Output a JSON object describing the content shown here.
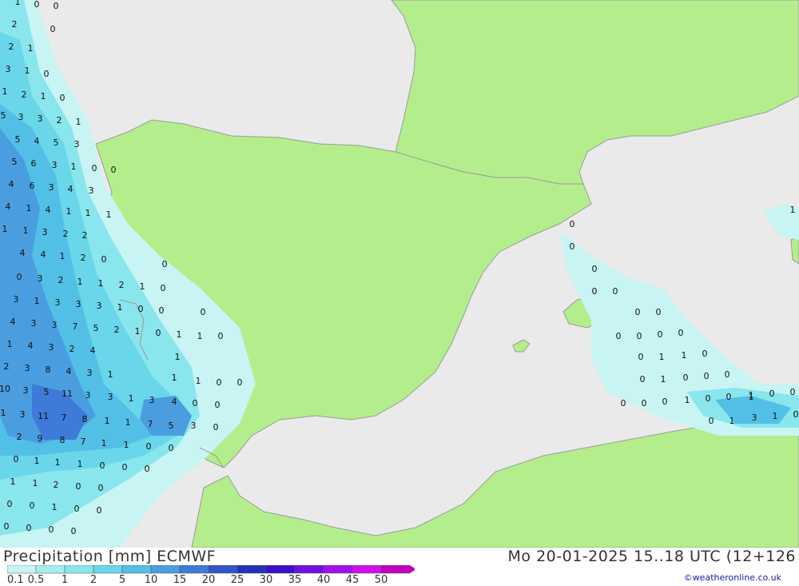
{
  "title_left": "Precipitation [mm] ECMWF",
  "title_right": "Mo 20-01-2025 15..18 UTC (12+126",
  "credit": "©weatheronline.co.uk",
  "legend": {
    "labels": [
      "0.1",
      "0.5",
      "1",
      "2",
      "5",
      "10",
      "15",
      "20",
      "25",
      "30",
      "35",
      "40",
      "45",
      "50"
    ],
    "colors": [
      "#c8f4f4",
      "#a6eef0",
      "#88e6ec",
      "#6ad6ea",
      "#52c0e6",
      "#4a9ee0",
      "#3e7ad8",
      "#3254cc",
      "#2232b8",
      "#3a10c8",
      "#7010e0",
      "#a010e8",
      "#d010e8",
      "#c000c0"
    ]
  },
  "map_colors": {
    "land": "#b4ee8c",
    "sea": "#eaeaea",
    "border": "#9a9a9a"
  },
  "values": [
    "1",
    "0",
    "0",
    "2",
    "0",
    "2",
    "1",
    "3",
    "1",
    "0",
    "1",
    "2",
    "1",
    "0",
    "5",
    "3",
    "3",
    "2",
    "1",
    "5",
    "4",
    "5",
    "3",
    "5",
    "6",
    "3",
    "1",
    "0",
    "0",
    "4",
    "6",
    "3",
    "4",
    "3",
    "4",
    "1",
    "4",
    "1",
    "1",
    "1",
    "1",
    "1",
    "3",
    "2",
    "2",
    "4",
    "4",
    "1",
    "2",
    "0",
    "0",
    "3",
    "2",
    "1",
    "1",
    "2",
    "1",
    "0",
    "0",
    "3",
    "1",
    "3",
    "3",
    "3",
    "1",
    "0",
    "0",
    "0",
    "4",
    "3",
    "3",
    "7",
    "5",
    "2",
    "1",
    "0",
    "1",
    "1",
    "0",
    "1",
    "4",
    "3",
    "2",
    "4",
    "1",
    "2",
    "3",
    "8",
    "4",
    "3",
    "1",
    "1",
    "1",
    "0",
    "0",
    "10",
    "3",
    "5",
    "11",
    "3",
    "3",
    "1",
    "3",
    "4",
    "0",
    "0",
    "1",
    "3",
    "11",
    "7",
    "8",
    "1",
    "1",
    "7",
    "5",
    "3",
    "0",
    "2",
    "9",
    "8",
    "7",
    "1",
    "1",
    "0",
    "0",
    "0",
    "1",
    "1",
    "1",
    "0",
    "0",
    "0",
    "1",
    "1",
    "2",
    "0",
    "0",
    "0",
    "0",
    "1",
    "0",
    "0",
    "0",
    "0",
    "0",
    "0",
    "0",
    "0",
    "0",
    "0",
    "0",
    "0",
    "0",
    "0",
    "0",
    "0",
    "0",
    "0",
    "1",
    "1",
    "0",
    "0",
    "1",
    "0",
    "0",
    "0",
    "0",
    "0",
    "0",
    "1",
    "0",
    "0",
    "1",
    "0",
    "0",
    "1",
    "1",
    "0",
    "1",
    "3",
    "1",
    "0",
    "0",
    "2",
    "1",
    "5",
    "1",
    "0"
  ]
}
